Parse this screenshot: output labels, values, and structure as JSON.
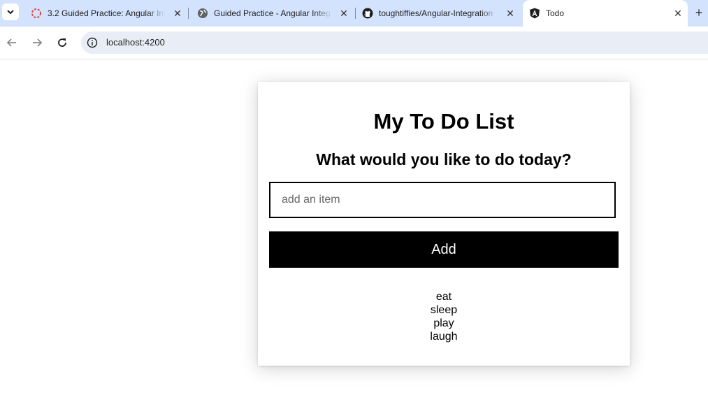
{
  "browser": {
    "tabs": [
      {
        "title": "3.2 Guided Practice: Angular Int",
        "icon": "canvas-lms-icon"
      },
      {
        "title": "Guided Practice - Angular Integ",
        "icon": "globe-icon"
      },
      {
        "title": "toughtiffies/Angular-Integration",
        "icon": "github-icon"
      },
      {
        "title": "Todo",
        "icon": "angular-icon"
      }
    ],
    "active_tab": 3,
    "new_tab_glyph": "+",
    "close_glyph": "✕",
    "address": "localhost:4200"
  },
  "page": {
    "heading": "My To Do List",
    "subheading": "What would you like to do today?",
    "input_placeholder": "add an item",
    "input_value": "",
    "add_label": "Add",
    "items": [
      "eat",
      "sleep",
      "play",
      "laugh"
    ]
  },
  "colors": {
    "tabstrip_bg": "#d3e3fd",
    "omnibox_bg": "#e9eef6",
    "button_bg": "#000000",
    "button_text": "#ffffff"
  }
}
